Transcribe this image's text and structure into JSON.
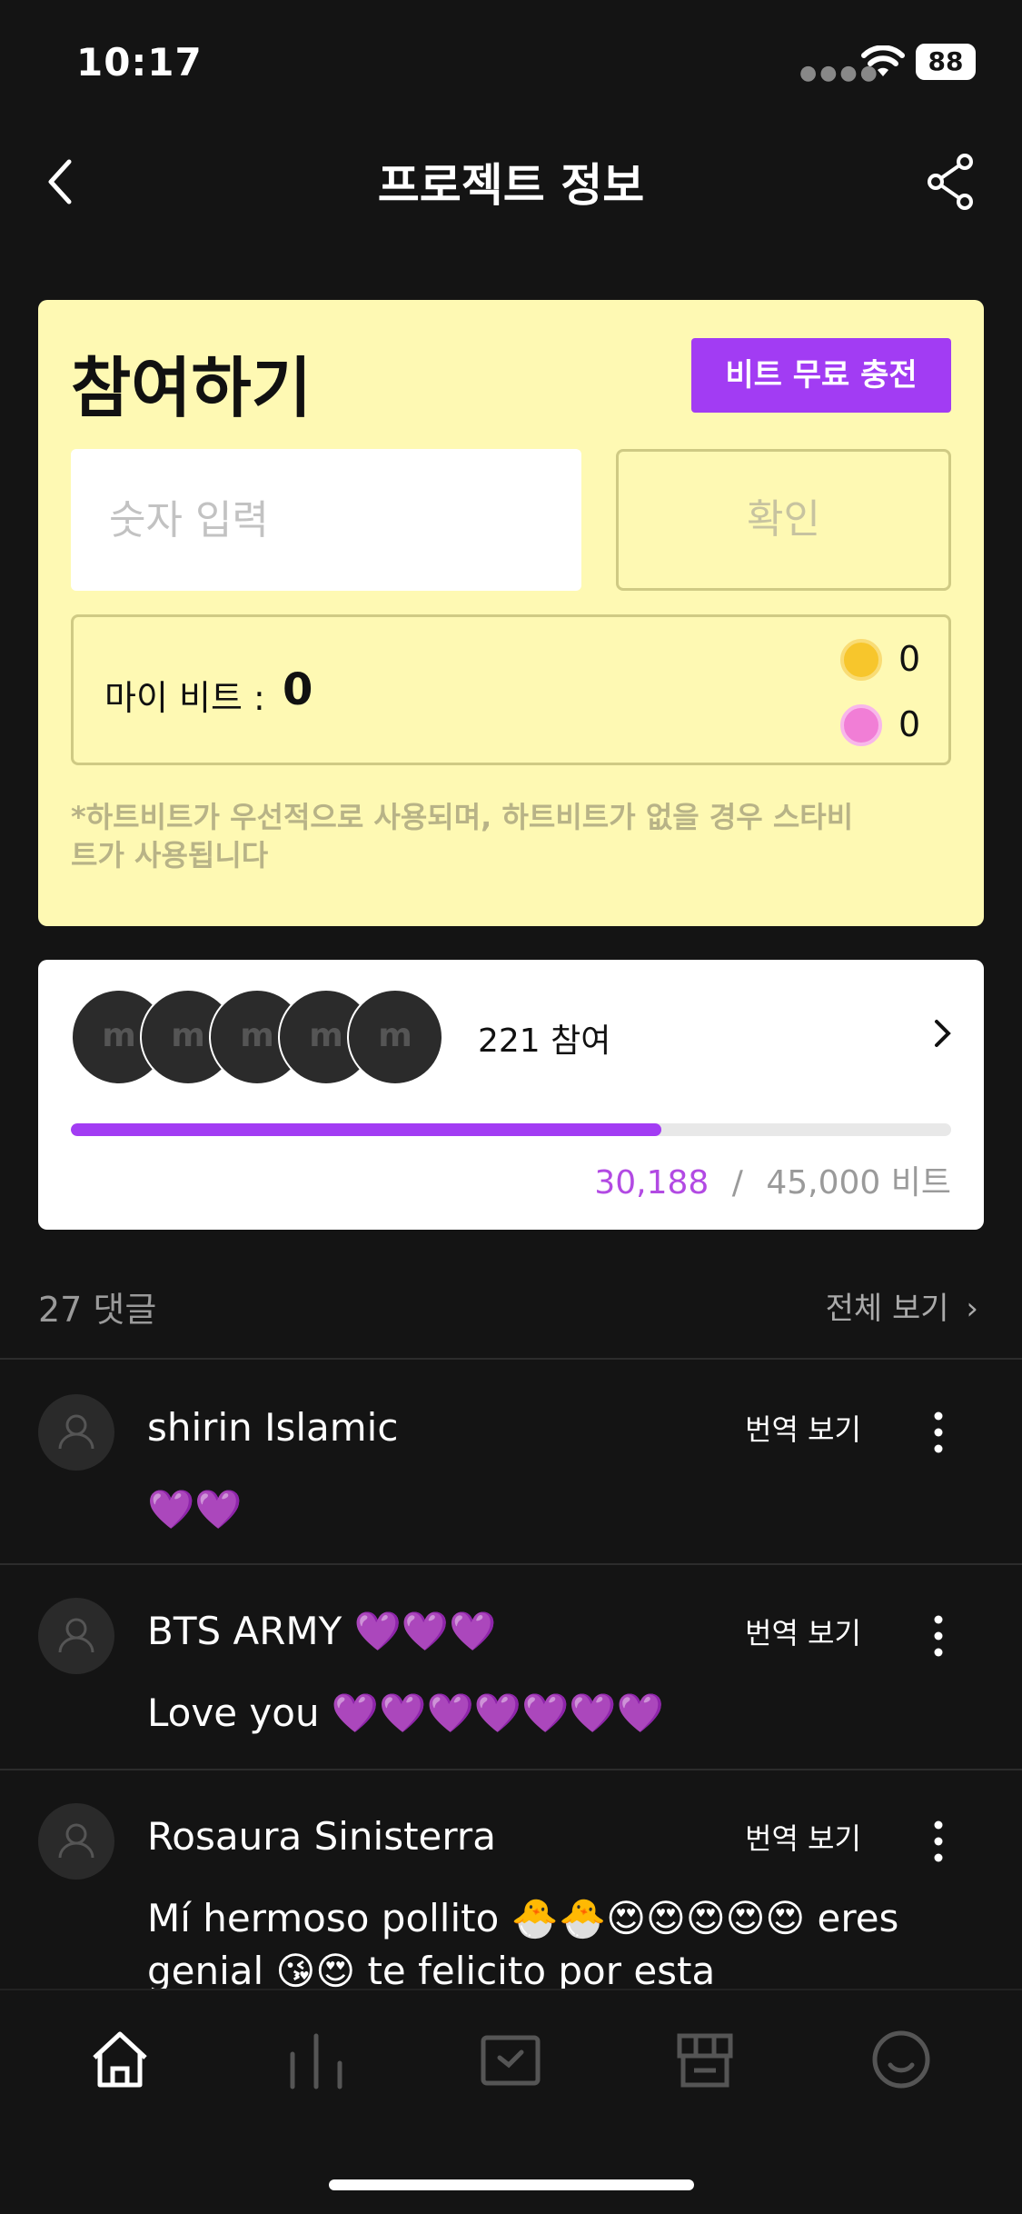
{
  "status": {
    "time": "10:17",
    "battery": "88"
  },
  "nav": {
    "title": "프로젝트 정보"
  },
  "join": {
    "heading": "참여하기",
    "charge_button": "비트 무료 충전",
    "number_placeholder": "숫자 입력",
    "confirm_button": "확인",
    "mybit_label": "마이 비트 :",
    "mybit_value": "0",
    "star_bit": "0",
    "heart_bit": "0",
    "note": "*하트비트가 우선적으로 사용되며, 하트비트가 없을 경우 스타비트가 사용됩니다"
  },
  "participation": {
    "avatar_labels": [
      "m",
      "m",
      "m",
      "m",
      "m"
    ],
    "count": "221 참여",
    "progress_fraction": 0.6709,
    "current": "30,188",
    "separator": "/",
    "goal": "45,000 비트"
  },
  "comments_header": {
    "count": "27 댓글",
    "view_all": "전체 보기"
  },
  "comments": [
    {
      "name": "shirin Islamic",
      "translate": "번역 보기",
      "text": "💜💜"
    },
    {
      "name": "BTS ARMY 💜💜💜",
      "translate": "번역 보기",
      "text": "Love you 💜💜💜💜💜💜💜"
    },
    {
      "name": "Rosaura Sinisterra",
      "translate": "번역 보기",
      "text": "Mí hermoso pollito 🐣🐣😍😍😍😍😍 eres genial 😘😍 te felicito por esta"
    }
  ],
  "colors": {
    "accent": "#a23cf3",
    "card": "#fef9b3",
    "background": "#141414"
  },
  "icons": [
    "back-icon",
    "share-icon",
    "chevron-right-icon",
    "more-vertical-icon",
    "home-icon",
    "chart-icon",
    "inbox-icon",
    "store-icon",
    "smile-icon"
  ]
}
